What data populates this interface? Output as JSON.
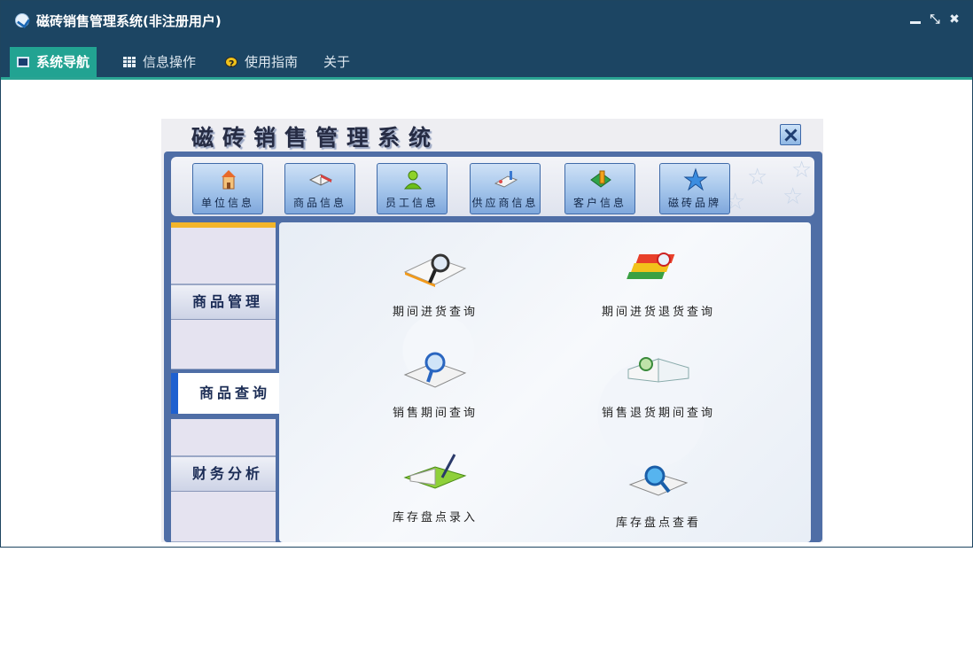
{
  "window": {
    "title": "磁砖销售管理系统(非注册用户)"
  },
  "tabs": [
    {
      "label": "系统导航",
      "icon": "nav-window-icon"
    },
    {
      "label": "信息操作",
      "icon": "grid-icon"
    },
    {
      "label": "使用指南",
      "icon": "help-icon"
    },
    {
      "label": "关于",
      "icon": ""
    }
  ],
  "inner_app": {
    "title": "磁砖销售管理系统",
    "toolbar": [
      {
        "label": "单位信息",
        "icon": "building-icon"
      },
      {
        "label": "商品信息",
        "icon": "book-icon"
      },
      {
        "label": "员工信息",
        "icon": "person-icon"
      },
      {
        "label": "供应商信息",
        "icon": "supplier-icon"
      },
      {
        "label": "客户信息",
        "icon": "customer-icon"
      },
      {
        "label": "磁砖品牌",
        "icon": "star-icon"
      }
    ],
    "sidebar": [
      {
        "label": "商品管理"
      },
      {
        "label": "商品查询",
        "active": true
      },
      {
        "label": "财务分析"
      }
    ],
    "queries": [
      {
        "label": "期间进货查询",
        "icon": "magnifier-book-icon"
      },
      {
        "label": "期间进货退货查询",
        "icon": "books-search-icon"
      },
      {
        "label": "销售期间查询",
        "icon": "magnifier-book-icon"
      },
      {
        "label": "销售退货期间查询",
        "icon": "open-book-icon"
      },
      {
        "label": "库存盘点录入",
        "icon": "pen-book-icon"
      },
      {
        "label": "库存盘点查看",
        "icon": "magnifier-book-icon"
      }
    ]
  },
  "colors": {
    "titlebar": "#1c4563",
    "accent": "#22a392",
    "inner_frame": "#4f6ea6"
  }
}
